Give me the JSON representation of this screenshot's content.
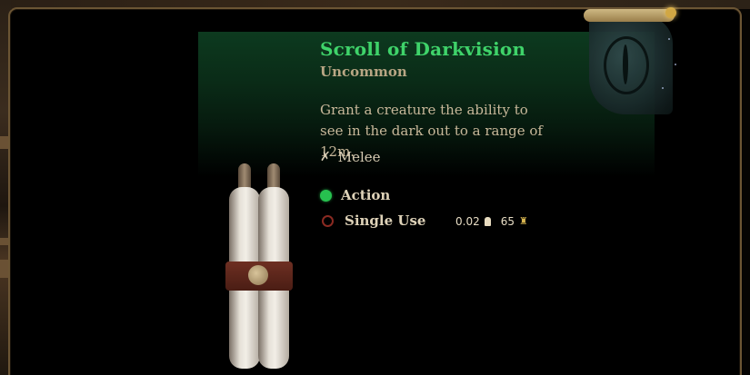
{
  "item": {
    "name": "Scroll of Darkvision",
    "rarity": "Uncommon",
    "description": "Grant a creature the ability to see in the dark out to a range of 12m.",
    "range_icon": "crossed-swords-icon",
    "range_label": "Melee",
    "costs": [
      {
        "icon": "action-dot-icon",
        "label": "Action",
        "color": "#27c04f"
      },
      {
        "icon": "single-use-icon",
        "label": "Single Use",
        "color": "#8a2a22"
      }
    ],
    "weight": "0.02",
    "weight_icon": "weight-icon",
    "value": "65",
    "value_icon": "gold-coin-icon"
  },
  "colors": {
    "title": "#3fd36a",
    "rarity": "#b8a684",
    "frame": "#6b5534",
    "header_glow": "#0d3a1f"
  }
}
